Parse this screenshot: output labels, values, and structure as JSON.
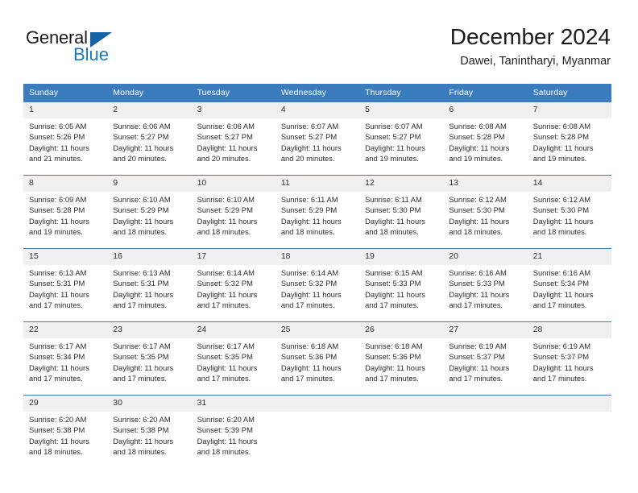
{
  "brand": {
    "name_part1": "General",
    "name_part2": "Blue"
  },
  "header": {
    "title": "December 2024",
    "subtitle": "Dawei, Tanintharyi, Myanmar"
  },
  "colors": {
    "header_band": "#3a7cbe",
    "day_number_band": "#f0f0f0",
    "brand_blue": "#1979bf",
    "text": "#2c2c2c"
  },
  "weekdays": [
    "Sunday",
    "Monday",
    "Tuesday",
    "Wednesday",
    "Thursday",
    "Friday",
    "Saturday"
  ],
  "weeks": [
    [
      {
        "day": "1",
        "sunrise": "Sunrise: 6:05 AM",
        "sunset": "Sunset: 5:26 PM",
        "daylight1": "Daylight: 11 hours",
        "daylight2": "and 21 minutes."
      },
      {
        "day": "2",
        "sunrise": "Sunrise: 6:06 AM",
        "sunset": "Sunset: 5:27 PM",
        "daylight1": "Daylight: 11 hours",
        "daylight2": "and 20 minutes."
      },
      {
        "day": "3",
        "sunrise": "Sunrise: 6:06 AM",
        "sunset": "Sunset: 5:27 PM",
        "daylight1": "Daylight: 11 hours",
        "daylight2": "and 20 minutes."
      },
      {
        "day": "4",
        "sunrise": "Sunrise: 6:07 AM",
        "sunset": "Sunset: 5:27 PM",
        "daylight1": "Daylight: 11 hours",
        "daylight2": "and 20 minutes."
      },
      {
        "day": "5",
        "sunrise": "Sunrise: 6:07 AM",
        "sunset": "Sunset: 5:27 PM",
        "daylight1": "Daylight: 11 hours",
        "daylight2": "and 19 minutes."
      },
      {
        "day": "6",
        "sunrise": "Sunrise: 6:08 AM",
        "sunset": "Sunset: 5:28 PM",
        "daylight1": "Daylight: 11 hours",
        "daylight2": "and 19 minutes."
      },
      {
        "day": "7",
        "sunrise": "Sunrise: 6:08 AM",
        "sunset": "Sunset: 5:28 PM",
        "daylight1": "Daylight: 11 hours",
        "daylight2": "and 19 minutes."
      }
    ],
    [
      {
        "day": "8",
        "sunrise": "Sunrise: 6:09 AM",
        "sunset": "Sunset: 5:28 PM",
        "daylight1": "Daylight: 11 hours",
        "daylight2": "and 19 minutes."
      },
      {
        "day": "9",
        "sunrise": "Sunrise: 6:10 AM",
        "sunset": "Sunset: 5:29 PM",
        "daylight1": "Daylight: 11 hours",
        "daylight2": "and 18 minutes."
      },
      {
        "day": "10",
        "sunrise": "Sunrise: 6:10 AM",
        "sunset": "Sunset: 5:29 PM",
        "daylight1": "Daylight: 11 hours",
        "daylight2": "and 18 minutes."
      },
      {
        "day": "11",
        "sunrise": "Sunrise: 6:11 AM",
        "sunset": "Sunset: 5:29 PM",
        "daylight1": "Daylight: 11 hours",
        "daylight2": "and 18 minutes."
      },
      {
        "day": "12",
        "sunrise": "Sunrise: 6:11 AM",
        "sunset": "Sunset: 5:30 PM",
        "daylight1": "Daylight: 11 hours",
        "daylight2": "and 18 minutes."
      },
      {
        "day": "13",
        "sunrise": "Sunrise: 6:12 AM",
        "sunset": "Sunset: 5:30 PM",
        "daylight1": "Daylight: 11 hours",
        "daylight2": "and 18 minutes."
      },
      {
        "day": "14",
        "sunrise": "Sunrise: 6:12 AM",
        "sunset": "Sunset: 5:30 PM",
        "daylight1": "Daylight: 11 hours",
        "daylight2": "and 18 minutes."
      }
    ],
    [
      {
        "day": "15",
        "sunrise": "Sunrise: 6:13 AM",
        "sunset": "Sunset: 5:31 PM",
        "daylight1": "Daylight: 11 hours",
        "daylight2": "and 17 minutes."
      },
      {
        "day": "16",
        "sunrise": "Sunrise: 6:13 AM",
        "sunset": "Sunset: 5:31 PM",
        "daylight1": "Daylight: 11 hours",
        "daylight2": "and 17 minutes."
      },
      {
        "day": "17",
        "sunrise": "Sunrise: 6:14 AM",
        "sunset": "Sunset: 5:32 PM",
        "daylight1": "Daylight: 11 hours",
        "daylight2": "and 17 minutes."
      },
      {
        "day": "18",
        "sunrise": "Sunrise: 6:14 AM",
        "sunset": "Sunset: 5:32 PM",
        "daylight1": "Daylight: 11 hours",
        "daylight2": "and 17 minutes."
      },
      {
        "day": "19",
        "sunrise": "Sunrise: 6:15 AM",
        "sunset": "Sunset: 5:33 PM",
        "daylight1": "Daylight: 11 hours",
        "daylight2": "and 17 minutes."
      },
      {
        "day": "20",
        "sunrise": "Sunrise: 6:16 AM",
        "sunset": "Sunset: 5:33 PM",
        "daylight1": "Daylight: 11 hours",
        "daylight2": "and 17 minutes."
      },
      {
        "day": "21",
        "sunrise": "Sunrise: 6:16 AM",
        "sunset": "Sunset: 5:34 PM",
        "daylight1": "Daylight: 11 hours",
        "daylight2": "and 17 minutes."
      }
    ],
    [
      {
        "day": "22",
        "sunrise": "Sunrise: 6:17 AM",
        "sunset": "Sunset: 5:34 PM",
        "daylight1": "Daylight: 11 hours",
        "daylight2": "and 17 minutes."
      },
      {
        "day": "23",
        "sunrise": "Sunrise: 6:17 AM",
        "sunset": "Sunset: 5:35 PM",
        "daylight1": "Daylight: 11 hours",
        "daylight2": "and 17 minutes."
      },
      {
        "day": "24",
        "sunrise": "Sunrise: 6:17 AM",
        "sunset": "Sunset: 5:35 PM",
        "daylight1": "Daylight: 11 hours",
        "daylight2": "and 17 minutes."
      },
      {
        "day": "25",
        "sunrise": "Sunrise: 6:18 AM",
        "sunset": "Sunset: 5:36 PM",
        "daylight1": "Daylight: 11 hours",
        "daylight2": "and 17 minutes."
      },
      {
        "day": "26",
        "sunrise": "Sunrise: 6:18 AM",
        "sunset": "Sunset: 5:36 PM",
        "daylight1": "Daylight: 11 hours",
        "daylight2": "and 17 minutes."
      },
      {
        "day": "27",
        "sunrise": "Sunrise: 6:19 AM",
        "sunset": "Sunset: 5:37 PM",
        "daylight1": "Daylight: 11 hours",
        "daylight2": "and 17 minutes."
      },
      {
        "day": "28",
        "sunrise": "Sunrise: 6:19 AM",
        "sunset": "Sunset: 5:37 PM",
        "daylight1": "Daylight: 11 hours",
        "daylight2": "and 17 minutes."
      }
    ],
    [
      {
        "day": "29",
        "sunrise": "Sunrise: 6:20 AM",
        "sunset": "Sunset: 5:38 PM",
        "daylight1": "Daylight: 11 hours",
        "daylight2": "and 18 minutes."
      },
      {
        "day": "30",
        "sunrise": "Sunrise: 6:20 AM",
        "sunset": "Sunset: 5:38 PM",
        "daylight1": "Daylight: 11 hours",
        "daylight2": "and 18 minutes."
      },
      {
        "day": "31",
        "sunrise": "Sunrise: 6:20 AM",
        "sunset": "Sunset: 5:39 PM",
        "daylight1": "Daylight: 11 hours",
        "daylight2": "and 18 minutes."
      },
      {
        "day": "",
        "sunrise": "",
        "sunset": "",
        "daylight1": "",
        "daylight2": ""
      },
      {
        "day": "",
        "sunrise": "",
        "sunset": "",
        "daylight1": "",
        "daylight2": ""
      },
      {
        "day": "",
        "sunrise": "",
        "sunset": "",
        "daylight1": "",
        "daylight2": ""
      },
      {
        "day": "",
        "sunrise": "",
        "sunset": "",
        "daylight1": "",
        "daylight2": ""
      }
    ]
  ]
}
